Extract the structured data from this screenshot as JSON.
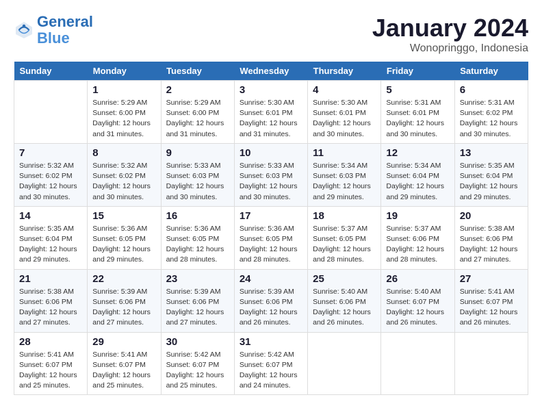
{
  "header": {
    "logo_line1": "General",
    "logo_line2": "Blue",
    "main_title": "January 2024",
    "subtitle": "Wonopringgo, Indonesia"
  },
  "columns": [
    "Sunday",
    "Monday",
    "Tuesday",
    "Wednesday",
    "Thursday",
    "Friday",
    "Saturday"
  ],
  "weeks": [
    [
      {
        "day": "",
        "info": ""
      },
      {
        "day": "1",
        "info": "Sunrise: 5:29 AM\nSunset: 6:00 PM\nDaylight: 12 hours\nand 31 minutes."
      },
      {
        "day": "2",
        "info": "Sunrise: 5:29 AM\nSunset: 6:00 PM\nDaylight: 12 hours\nand 31 minutes."
      },
      {
        "day": "3",
        "info": "Sunrise: 5:30 AM\nSunset: 6:01 PM\nDaylight: 12 hours\nand 31 minutes."
      },
      {
        "day": "4",
        "info": "Sunrise: 5:30 AM\nSunset: 6:01 PM\nDaylight: 12 hours\nand 30 minutes."
      },
      {
        "day": "5",
        "info": "Sunrise: 5:31 AM\nSunset: 6:01 PM\nDaylight: 12 hours\nand 30 minutes."
      },
      {
        "day": "6",
        "info": "Sunrise: 5:31 AM\nSunset: 6:02 PM\nDaylight: 12 hours\nand 30 minutes."
      }
    ],
    [
      {
        "day": "7",
        "info": "Sunrise: 5:32 AM\nSunset: 6:02 PM\nDaylight: 12 hours\nand 30 minutes."
      },
      {
        "day": "8",
        "info": "Sunrise: 5:32 AM\nSunset: 6:02 PM\nDaylight: 12 hours\nand 30 minutes."
      },
      {
        "day": "9",
        "info": "Sunrise: 5:33 AM\nSunset: 6:03 PM\nDaylight: 12 hours\nand 30 minutes."
      },
      {
        "day": "10",
        "info": "Sunrise: 5:33 AM\nSunset: 6:03 PM\nDaylight: 12 hours\nand 30 minutes."
      },
      {
        "day": "11",
        "info": "Sunrise: 5:34 AM\nSunset: 6:03 PM\nDaylight: 12 hours\nand 29 minutes."
      },
      {
        "day": "12",
        "info": "Sunrise: 5:34 AM\nSunset: 6:04 PM\nDaylight: 12 hours\nand 29 minutes."
      },
      {
        "day": "13",
        "info": "Sunrise: 5:35 AM\nSunset: 6:04 PM\nDaylight: 12 hours\nand 29 minutes."
      }
    ],
    [
      {
        "day": "14",
        "info": "Sunrise: 5:35 AM\nSunset: 6:04 PM\nDaylight: 12 hours\nand 29 minutes."
      },
      {
        "day": "15",
        "info": "Sunrise: 5:36 AM\nSunset: 6:05 PM\nDaylight: 12 hours\nand 29 minutes."
      },
      {
        "day": "16",
        "info": "Sunrise: 5:36 AM\nSunset: 6:05 PM\nDaylight: 12 hours\nand 28 minutes."
      },
      {
        "day": "17",
        "info": "Sunrise: 5:36 AM\nSunset: 6:05 PM\nDaylight: 12 hours\nand 28 minutes."
      },
      {
        "day": "18",
        "info": "Sunrise: 5:37 AM\nSunset: 6:05 PM\nDaylight: 12 hours\nand 28 minutes."
      },
      {
        "day": "19",
        "info": "Sunrise: 5:37 AM\nSunset: 6:06 PM\nDaylight: 12 hours\nand 28 minutes."
      },
      {
        "day": "20",
        "info": "Sunrise: 5:38 AM\nSunset: 6:06 PM\nDaylight: 12 hours\nand 27 minutes."
      }
    ],
    [
      {
        "day": "21",
        "info": "Sunrise: 5:38 AM\nSunset: 6:06 PM\nDaylight: 12 hours\nand 27 minutes."
      },
      {
        "day": "22",
        "info": "Sunrise: 5:39 AM\nSunset: 6:06 PM\nDaylight: 12 hours\nand 27 minutes."
      },
      {
        "day": "23",
        "info": "Sunrise: 5:39 AM\nSunset: 6:06 PM\nDaylight: 12 hours\nand 27 minutes."
      },
      {
        "day": "24",
        "info": "Sunrise: 5:39 AM\nSunset: 6:06 PM\nDaylight: 12 hours\nand 26 minutes."
      },
      {
        "day": "25",
        "info": "Sunrise: 5:40 AM\nSunset: 6:06 PM\nDaylight: 12 hours\nand 26 minutes."
      },
      {
        "day": "26",
        "info": "Sunrise: 5:40 AM\nSunset: 6:07 PM\nDaylight: 12 hours\nand 26 minutes."
      },
      {
        "day": "27",
        "info": "Sunrise: 5:41 AM\nSunset: 6:07 PM\nDaylight: 12 hours\nand 26 minutes."
      }
    ],
    [
      {
        "day": "28",
        "info": "Sunrise: 5:41 AM\nSunset: 6:07 PM\nDaylight: 12 hours\nand 25 minutes."
      },
      {
        "day": "29",
        "info": "Sunrise: 5:41 AM\nSunset: 6:07 PM\nDaylight: 12 hours\nand 25 minutes."
      },
      {
        "day": "30",
        "info": "Sunrise: 5:42 AM\nSunset: 6:07 PM\nDaylight: 12 hours\nand 25 minutes."
      },
      {
        "day": "31",
        "info": "Sunrise: 5:42 AM\nSunset: 6:07 PM\nDaylight: 12 hours\nand 24 minutes."
      },
      {
        "day": "",
        "info": ""
      },
      {
        "day": "",
        "info": ""
      },
      {
        "day": "",
        "info": ""
      }
    ]
  ]
}
